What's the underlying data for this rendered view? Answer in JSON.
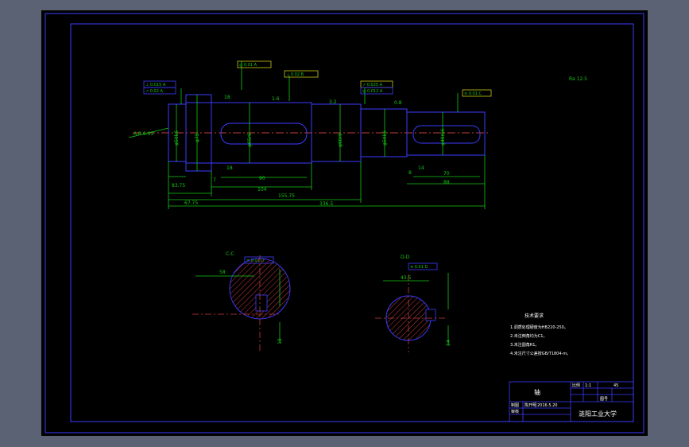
{
  "drawing": {
    "part_name": "轴",
    "company": "涟阳工业大学",
    "title_block": {
      "scale_label": "比例",
      "scale_value": "1:1",
      "material": "45",
      "sheet_label": "图号",
      "drawn_label": "制图",
      "checked_label": "审核",
      "name": "陈开明",
      "date": "2016.5.20"
    },
    "tech_requirements": {
      "heading": "技术要求",
      "items": [
        "1.调质处理硬度为HB220-250。",
        "2.未注倒角均为C1。",
        "3.未注圆角R1。",
        "4.未注尺寸公差按GB/T1804-m。"
      ]
    },
    "roughness_note": "Ra 12.5",
    "section_labels": [
      "C-C",
      "D-D"
    ],
    "dims": {
      "d1": "φ50k6",
      "d2": "φ75",
      "d3": "φ65r6",
      "d4": "φ60r6",
      "d5": "φ50k6",
      "d6": "φ40m6",
      "len1": "83.75",
      "len2": "67.75",
      "len3": "104",
      "len4": "155.75",
      "len5": "336.5",
      "key1": "90",
      "key2": "70",
      "len6": "88",
      "small1": "7",
      "small2": "8",
      "key_w1": "18",
      "key_w2": "14",
      "sec1_depth": "58",
      "sec2_depth": "43.5",
      "sec1_width": "18",
      "sec2_width": "14",
      "roughness_a": "1.6",
      "roughness_b": "3.2",
      "roughness_c": "0.8"
    },
    "tol_frames": [
      "⊥ 0.015 A",
      "↗ 0.02 A",
      "◎ 0.01 A",
      "⊥ 0.02 B",
      "↗ 0.025 A",
      "◎ 0.012 A",
      "≡ 0.01 C",
      "≡ 0.01 D"
    ],
    "side_note": "A-B 0.03"
  }
}
